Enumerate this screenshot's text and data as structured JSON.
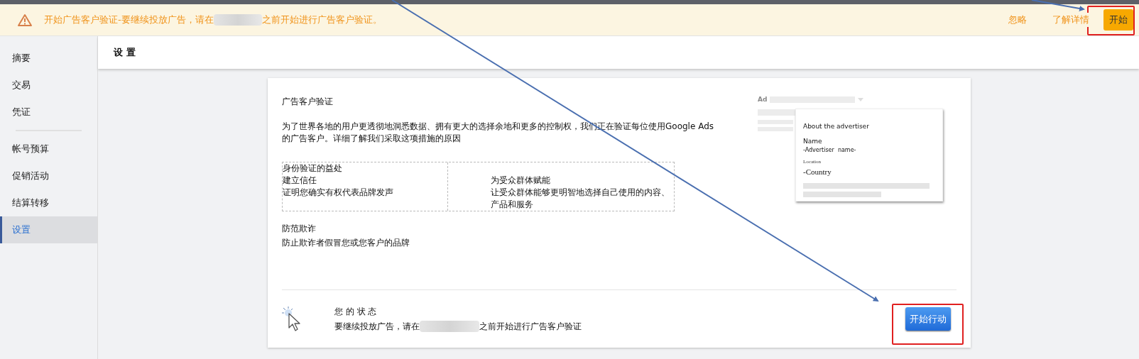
{
  "banner": {
    "text_before": "开始广告客户验证-要继续投放广告，请在",
    "text_after": "之前开始进行广告客户验证。",
    "dismiss": "忽略",
    "learn_more": "了解详情",
    "start": "开始"
  },
  "sidebar": {
    "items": [
      {
        "label": "摘要",
        "selected": false
      },
      {
        "label": "交易",
        "selected": false
      },
      {
        "label": "凭证",
        "selected": false
      },
      {
        "label": "帐号预算",
        "selected": false
      },
      {
        "label": "促销活动",
        "selected": false
      },
      {
        "label": "结算转移",
        "selected": false
      },
      {
        "label": "设置",
        "selected": true
      }
    ]
  },
  "header": {
    "title": "设 置"
  },
  "card": {
    "title": "广告客户验证",
    "description": "为了世界各地的用户更透彻地洞悉数据、拥有更大的选择余地和更多的控制权，我们正在验证每位使用Google Ads 的广告客户。详细了解我们采取这项措施的原因",
    "benefits_title": "身份验证的益处",
    "benefits": [
      {
        "title": "建立信任",
        "text": "证明您确实有权代表品牌发声"
      },
      {
        "title": "为受众群体赋能",
        "text": "让受众群体能够更明智地选择自己使用的内容、产品和服务"
      }
    ],
    "fraud": {
      "title": "防范欺诈",
      "text": "防止欺诈者假冒您或您客户的品牌"
    },
    "preview": {
      "ad_label": "Ad",
      "popup_title": "About the advertiser",
      "name_label": "Name",
      "name_value": "-Advertiser  name-",
      "location_label": "Location",
      "location_value": "-Country"
    },
    "status": {
      "title": "您 的 状 态",
      "text_before": "要继续投放广告，请在",
      "text_after": "之前开始进行广告客户验证",
      "action": "开始行动"
    }
  }
}
